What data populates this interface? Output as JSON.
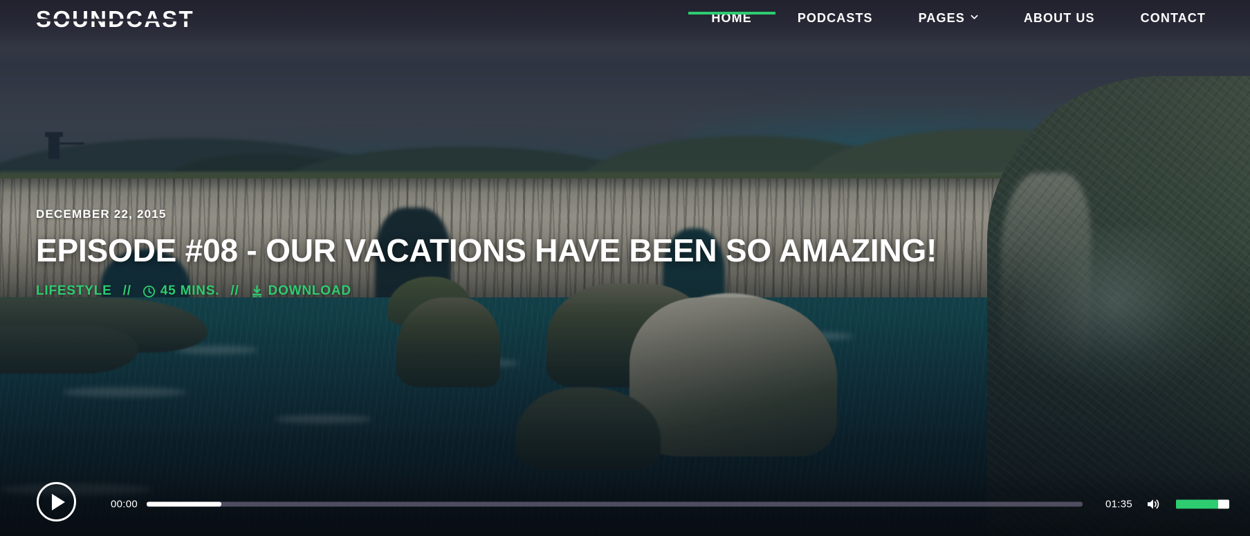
{
  "brand": {
    "logo_text": "SOUNDCAST"
  },
  "nav": {
    "items": [
      {
        "label": "HOME",
        "icon": "",
        "active": true
      },
      {
        "label": "PODCASTS",
        "icon": "",
        "active": false
      },
      {
        "label": "PAGES",
        "icon": "chevron-down-icon",
        "active": false
      },
      {
        "label": "ABOUT US",
        "icon": "",
        "active": false
      },
      {
        "label": "CONTACT",
        "icon": "",
        "active": false
      }
    ]
  },
  "hero": {
    "date": "DECEMBER 22, 2015",
    "title": "EPISODE #08 - OUR VACATIONS HAVE BEEN SO AMAZING!",
    "category": "LIFESTYLE",
    "separator": "//",
    "duration": "45 MINS.",
    "duration_icon": "clock-icon",
    "download_label": "DOWNLOAD",
    "download_icon": "download-icon"
  },
  "player": {
    "play_icon": "play-icon",
    "current_time": "00:00",
    "duration": "01:35",
    "progress_percent": 8,
    "volume_icon": "volume-icon",
    "volume_percent": 79
  },
  "colors": {
    "accent_green": "#2ecc71",
    "header_dark": "#20212d",
    "text_white": "#ffffff",
    "track_track": "#6a647c"
  }
}
